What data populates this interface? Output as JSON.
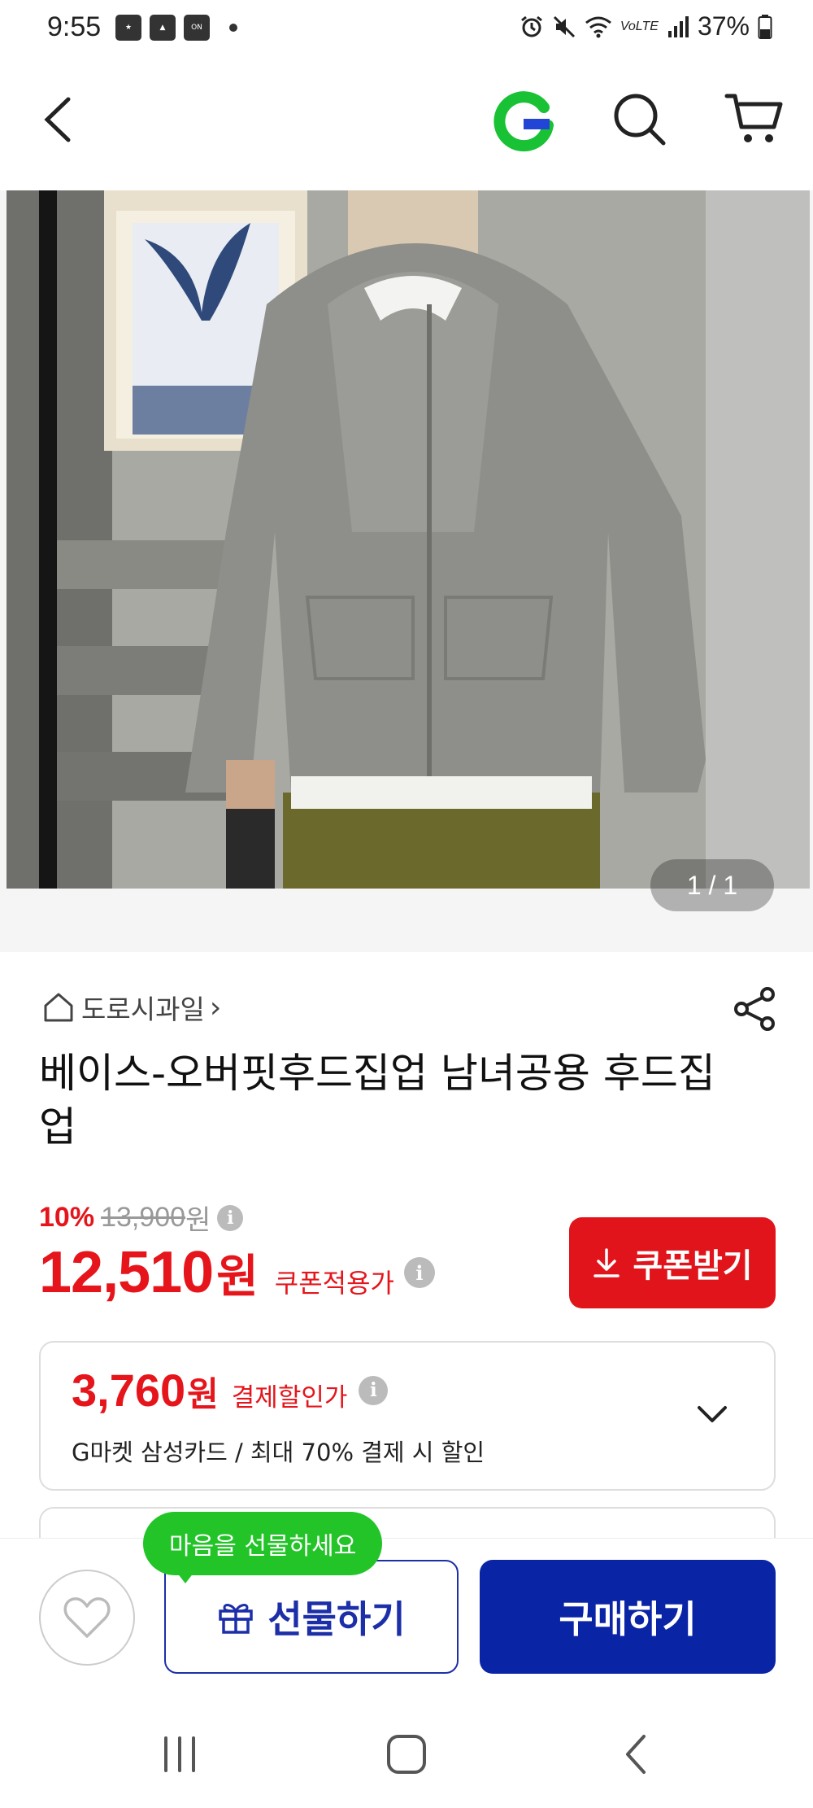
{
  "status_bar": {
    "time": "9:55",
    "battery": "37%",
    "network": "VoLTE"
  },
  "top_nav": {
    "logo_letter": "G"
  },
  "gallery": {
    "counter": "1 / 1"
  },
  "store": {
    "name": "도로시과일",
    "arrow": "›"
  },
  "product": {
    "title": "베이스-오버핏후드집업 남녀공용 후드집업"
  },
  "pricing": {
    "discount_rate": "10%",
    "original_price": "13,900",
    "original_unit": "원",
    "sale_price": "12,510",
    "sale_unit": "원",
    "coupon_price_label": "쿠폰적용가",
    "coupon_button_label": "쿠폰받기",
    "info_glyph": "i"
  },
  "card_discount": {
    "price": "3,760",
    "unit": "원",
    "label": "결제할인가",
    "description": "G마켓 삼성카드 / 최대 70% 결제 시 할인"
  },
  "bottom_bar": {
    "gift_bubble": "마음을 선물하세요",
    "gift_label": "선물하기",
    "buy_label": "구매하기"
  },
  "colors": {
    "accent_red": "#e0141a",
    "brand_blue": "#0a24a6",
    "bubble_green": "#22c428",
    "logo_green": "#19c235"
  },
  "icons": [
    "back-icon",
    "gmarket-logo",
    "search-icon",
    "cart-icon",
    "home-icon",
    "share-icon",
    "info-icon",
    "download-icon",
    "chevron-down-icon",
    "heart-icon",
    "gift-icon",
    "recent-apps-icon",
    "home-nav-icon",
    "back-nav-icon"
  ]
}
